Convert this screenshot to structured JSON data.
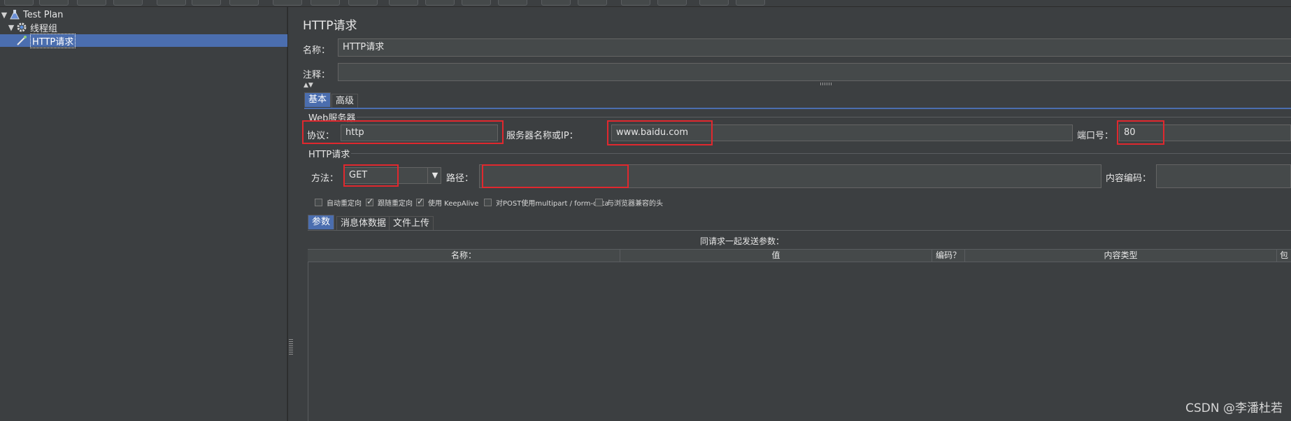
{
  "tree": {
    "items": [
      {
        "label": "Test Plan",
        "icon": "flask-icon",
        "expanded": true
      },
      {
        "label": "线程组",
        "icon": "gear-icon",
        "expanded": true
      },
      {
        "label": "HTTP请求",
        "icon": "sampler-icon",
        "selected": true
      }
    ]
  },
  "panel": {
    "title": "HTTP请求",
    "name_label": "名称：",
    "name_value": "HTTP请求",
    "comment_label": "注释：",
    "comment_value": "",
    "tabs": [
      {
        "label": "基本",
        "active": true
      },
      {
        "label": "高级",
        "active": false
      }
    ],
    "web_server": {
      "group_title": "Web服务器",
      "protocol_label": "协议：",
      "protocol_value": "http",
      "server_label": "服务器名称或IP：",
      "server_value": "www.baidu.com",
      "port_label": "端口号：",
      "port_value": "80"
    },
    "http_request": {
      "group_title": "HTTP请求",
      "method_label": "方法：",
      "method_value": "GET",
      "path_label": "路径：",
      "path_value": "",
      "encoding_label": "内容编码：",
      "encoding_value": ""
    },
    "checkboxes": [
      {
        "label": "自动重定向",
        "checked": false
      },
      {
        "label": "跟随重定向",
        "checked": true
      },
      {
        "label": "使用 KeepAlive",
        "checked": true
      },
      {
        "label": "对POST使用multipart / form-data",
        "checked": false
      },
      {
        "label": "与浏览器兼容的头",
        "checked": false
      }
    ],
    "sub_tabs": [
      {
        "label": "参数",
        "active": true
      },
      {
        "label": "消息体数据",
        "active": false
      },
      {
        "label": "文件上传",
        "active": false
      }
    ],
    "params_title": "同请求一起发送参数：",
    "columns": [
      "名称：",
      "值",
      "编码？",
      "内容类型",
      "包"
    ]
  },
  "watermark": "CSDN @李潘杜若",
  "colors": {
    "background": "#3c3f41",
    "selection": "#4b6eaf",
    "field": "#45494a",
    "highlight_box": "#e0282e"
  }
}
